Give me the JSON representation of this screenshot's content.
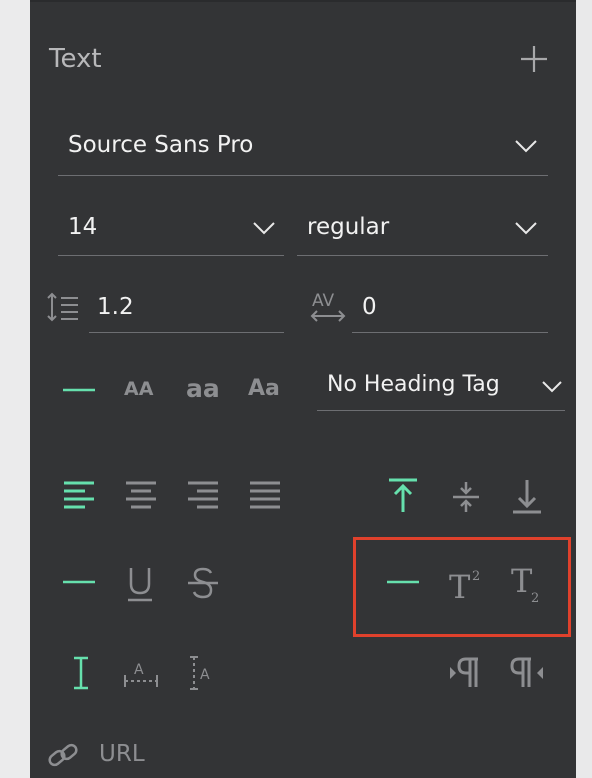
{
  "section": {
    "title": "Text"
  },
  "font_family": {
    "value": "Source Sans Pro"
  },
  "font_size": {
    "value": "14"
  },
  "font_weight": {
    "value": "regular"
  },
  "line_height": {
    "value": "1.2"
  },
  "letter_spacing": {
    "value": "0"
  },
  "heading_tag": {
    "value": "No Heading Tag"
  },
  "case_options": {
    "upper_small": "AA",
    "lower": "aa",
    "title": "Aa"
  },
  "url_label": "URL",
  "colors": {
    "accent": "#66e0ad",
    "highlight": "#e0412c",
    "panel": "#333436"
  }
}
